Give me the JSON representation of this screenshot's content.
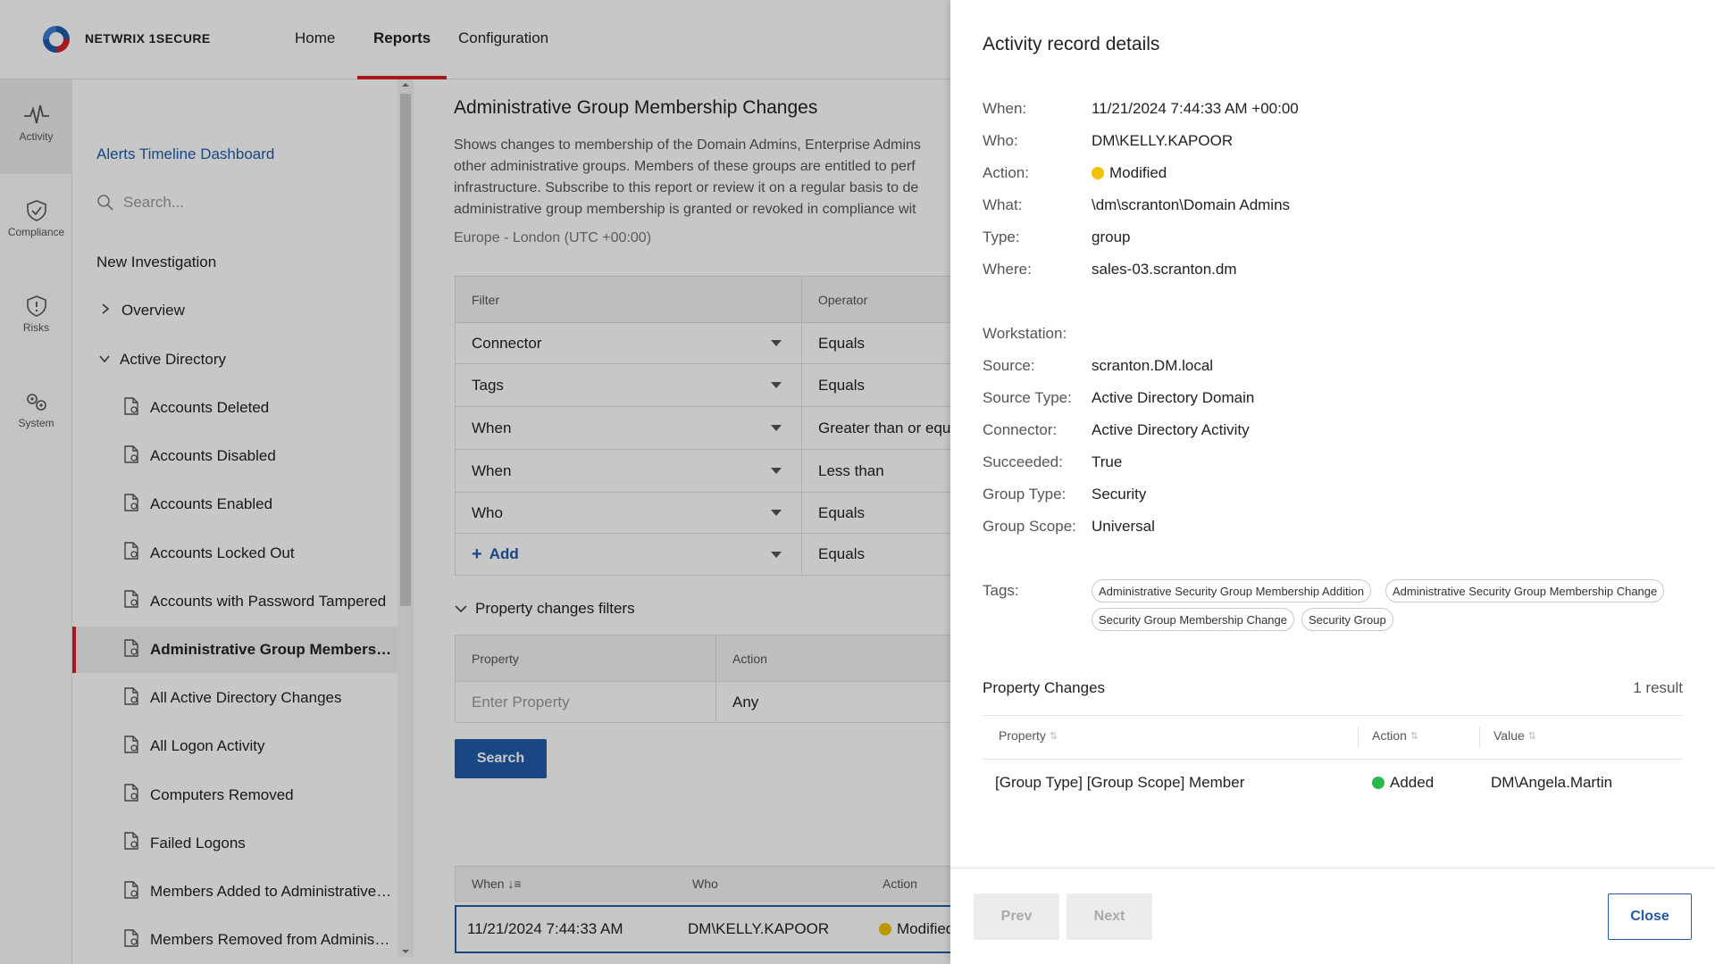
{
  "header": {
    "brand": "NETWRIX 1SECURE",
    "tabs": [
      {
        "label": "Home"
      },
      {
        "label": "Reports"
      },
      {
        "label": "Configuration"
      }
    ],
    "active_tab": "Reports",
    "accent_color": "#d71f28"
  },
  "rail": {
    "items": [
      {
        "label": "Activity",
        "icon": "activity-icon"
      },
      {
        "label": "Compliance",
        "icon": "shield-check-icon"
      },
      {
        "label": "Risks",
        "icon": "shield-alert-icon"
      },
      {
        "label": "System",
        "icon": "gears-icon"
      }
    ],
    "active": "Activity"
  },
  "sidebar": {
    "dashboard_link": "Alerts Timeline Dashboard",
    "search_placeholder": "Search...",
    "new_investigation": "New Investigation",
    "overview": "Overview",
    "active_directory": "Active Directory",
    "reports": [
      "Accounts Deleted",
      "Accounts Disabled",
      "Accounts Enabled",
      "Accounts Locked Out",
      "Accounts with Password Tampered",
      "Administrative Group Membershi...",
      "All Active Directory Changes",
      "All Logon Activity",
      "Computers Removed",
      "Failed Logons",
      "Members Added to Administrative ...",
      "Members Removed from Administr..."
    ],
    "selected_report": "Administrative Group Membershi..."
  },
  "main": {
    "title": "Administrative Group Membership Changes",
    "description_lines": [
      "Shows changes to membership of the Domain Admins, Enterprise Admins",
      "other administrative groups. Members of these groups are entitled to perf",
      "infrastructure. Subscribe to this report or review it on a regular basis to de",
      "administrative group membership is granted or revoked in compliance wit"
    ],
    "timezone": "Europe - London (UTC +00:00)",
    "filters": {
      "col_filter": "Filter",
      "col_operator": "Operator",
      "rows": [
        {
          "filter": "Connector",
          "operator": "Equals"
        },
        {
          "filter": "Tags",
          "operator": "Equals"
        },
        {
          "filter": "When",
          "operator": "Greater than or equa"
        },
        {
          "filter": "When",
          "operator": "Less than"
        },
        {
          "filter": "Who",
          "operator": "Equals"
        }
      ],
      "add_label": "Add",
      "add_operator": "Equals"
    },
    "property_filters": {
      "toggle_label": "Property changes filters",
      "col_property": "Property",
      "col_action": "Action",
      "property_placeholder": "Enter Property",
      "action_value": "Any"
    },
    "search_button": "Search",
    "results": {
      "col_when": "When",
      "col_who": "Who",
      "col_action": "Action",
      "row": {
        "when": "11/21/2024 7:44:33 AM",
        "who": "DM\\KELLY.KAPOOR",
        "action": "Modified"
      }
    }
  },
  "panel": {
    "title": "Activity record details",
    "fields_top": [
      {
        "label": "When:",
        "value": "11/21/2024 7:44:33 AM +00:00"
      },
      {
        "label": "Who:",
        "value": "DM\\KELLY.KAPOOR"
      },
      {
        "label": "Action:",
        "value": "Modified"
      },
      {
        "label": "What:",
        "value": "\\dm\\scranton\\Domain Admins"
      },
      {
        "label": "Type:",
        "value": "group"
      },
      {
        "label": "Where:",
        "value": "sales-03.scranton.dm"
      }
    ],
    "fields_bottom": [
      {
        "label": "Workstation:",
        "value": ""
      },
      {
        "label": "Source:",
        "value": "scranton.DM.local"
      },
      {
        "label": "Source Type:",
        "value": "Active Directory Domain"
      },
      {
        "label": "Connector:",
        "value": "Active Directory Activity"
      },
      {
        "label": "Succeeded:",
        "value": "True"
      },
      {
        "label": "Group Type:",
        "value": "Security"
      },
      {
        "label": "Group Scope:",
        "value": "Universal"
      }
    ],
    "tags_label": "Tags:",
    "tags": [
      "Administrative Security Group Membership Addition",
      "Administrative Security Group Membership Change",
      "Security Group Membership Change",
      "Security Group"
    ],
    "property_changes": {
      "title": "Property Changes",
      "count": "1 result",
      "col_property": "Property",
      "col_action": "Action",
      "col_value": "Value",
      "rows": [
        {
          "property": "[Group Type] [Group Scope] Member",
          "action": "Added",
          "value": "DM\\Angela.Martin"
        }
      ]
    },
    "buttons": {
      "prev": "Prev",
      "next": "Next",
      "close": "Close"
    },
    "status_colors": {
      "modified": "#f2c200",
      "added": "#2db84d"
    }
  }
}
